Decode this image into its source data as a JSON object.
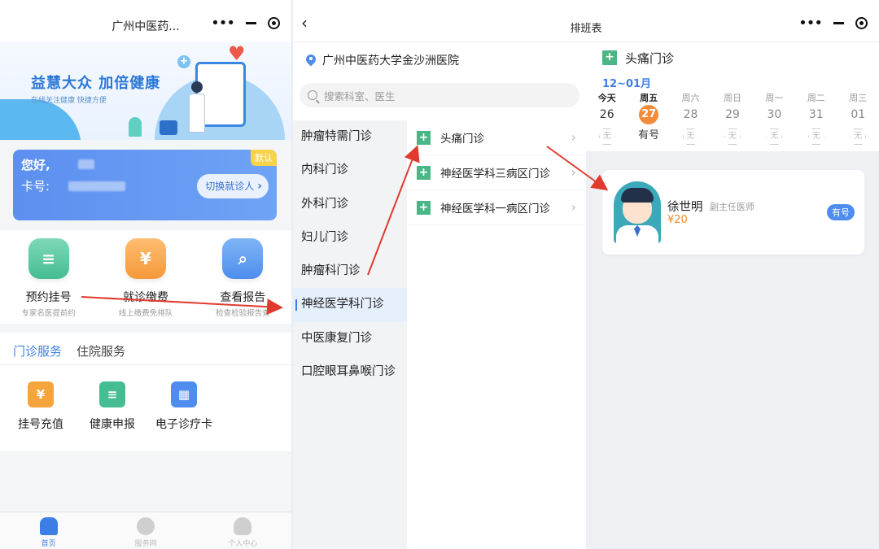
{
  "left": {
    "title": "广州中医药...",
    "banner": {
      "title": "益慧大众  加倍健康",
      "subtitle": "在线关注健康 快捷方便"
    },
    "card": {
      "hello": "您好,",
      "card_no": "卡号:",
      "default_badge": "默认",
      "switch_label": "切换就诊人"
    },
    "quick": [
      {
        "label": "预约挂号",
        "sub": "专家名医提前约",
        "icon": "calendar-list-icon",
        "glyph": "≡"
      },
      {
        "label": "就诊缴费",
        "sub": "线上缴费免排队",
        "icon": "yen-wallet-icon",
        "glyph": "¥"
      },
      {
        "label": "查看报告",
        "sub": "检查检验报告查",
        "icon": "report-search-icon",
        "glyph": "⌕"
      }
    ],
    "service_tabs": [
      "门诊服务",
      "住院服务"
    ],
    "services": [
      {
        "label": "挂号充值",
        "icon": "money-bag-icon",
        "color": "#f5a53b",
        "glyph": "¥"
      },
      {
        "label": "健康申报",
        "icon": "clipboard-icon",
        "color": "#46bc93",
        "glyph": "≡"
      },
      {
        "label": "电子诊疗卡",
        "icon": "calendar-card-icon",
        "color": "#4e8ded",
        "glyph": "▦"
      }
    ],
    "tabbar": [
      {
        "label": "首页",
        "icon": "home-icon",
        "color": "#3d7ee6"
      },
      {
        "label": "服务网",
        "icon": "globe-icon",
        "color": "#cfcfcf"
      },
      {
        "label": "个人中心",
        "icon": "person-icon",
        "color": "#cfcfcf"
      }
    ]
  },
  "right": {
    "title": "排班表",
    "hospital": "广州中医药大学金沙洲医院",
    "search_placeholder": "搜索科室、医生",
    "departments": [
      "肿瘤特需门诊",
      "内科门诊",
      "外科门诊",
      "妇儿门诊",
      "肿瘤科门诊",
      "神经医学科门诊",
      "中医康复门诊",
      "口腔眼耳鼻喉门诊"
    ],
    "active_department_index": 5,
    "subdepartments": [
      "头痛门诊",
      "神经医学科三病区门诊",
      "神经医学科一病区门诊"
    ],
    "schedule": {
      "clinic": "头痛门诊",
      "month_range": "12~01月",
      "days": [
        {
          "weekday": "今天",
          "date": "26",
          "status": "无",
          "weekday_strong": true
        },
        {
          "weekday": "周五",
          "date": "27",
          "status": "有号",
          "selected": true,
          "weekday_strong": true
        },
        {
          "weekday": "周六",
          "date": "28",
          "status": "无"
        },
        {
          "weekday": "周日",
          "date": "29",
          "status": "无"
        },
        {
          "weekday": "周一",
          "date": "30",
          "status": "无"
        },
        {
          "weekday": "周二",
          "date": "31",
          "status": "无"
        },
        {
          "weekday": "周三",
          "date": "01",
          "status": "无"
        }
      ],
      "doctor": {
        "name": "徐世明",
        "title": "副主任医师",
        "price": "¥20",
        "badge": "有号"
      }
    }
  },
  "capsule_icons": [
    "more-dots-icon",
    "minimize-icon",
    "close-target-icon"
  ]
}
